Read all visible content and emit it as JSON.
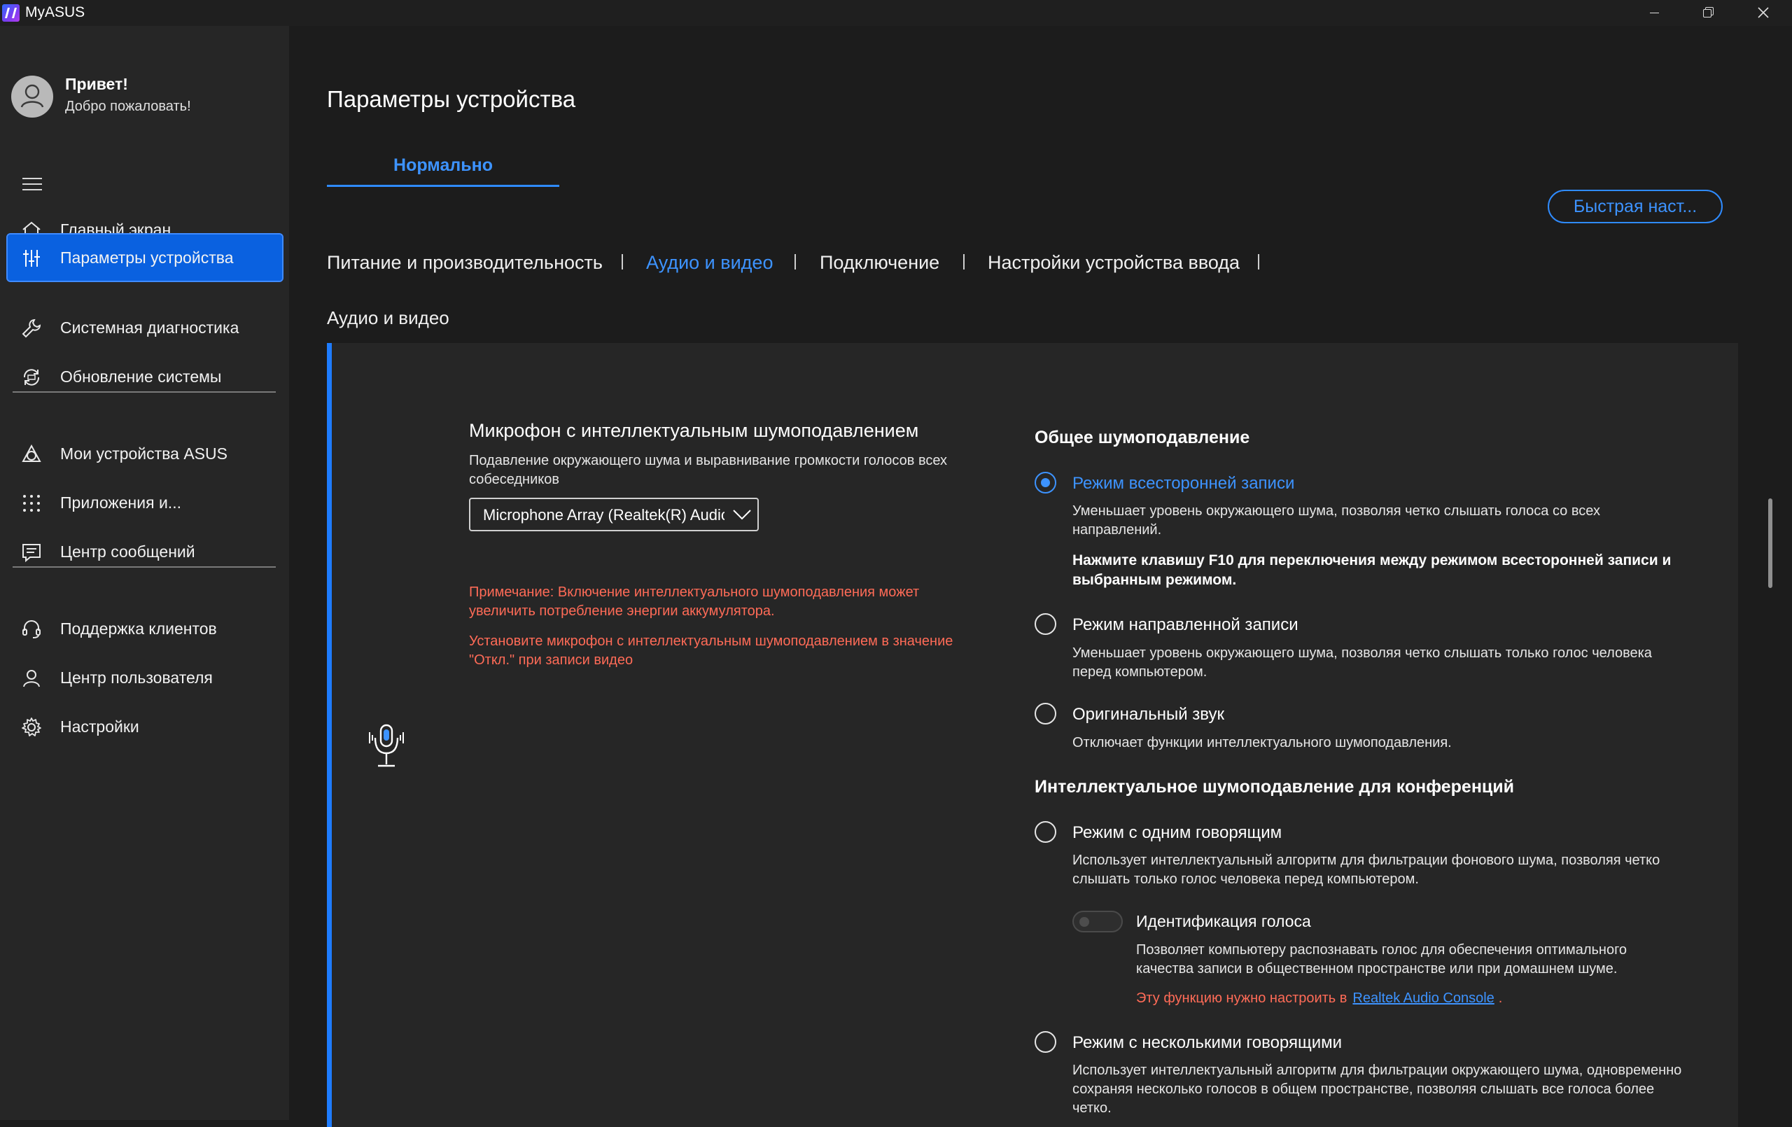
{
  "window": {
    "title": "MyASUS"
  },
  "sidebar": {
    "greeting_title": "Привет!",
    "greeting_subtitle": "Добро пожаловать!",
    "items": [
      {
        "label": "Главный экран",
        "icon": "home-icon",
        "active": false
      },
      {
        "label": "Параметры устройства",
        "icon": "sliders-icon",
        "active": true
      },
      {
        "label": "Системная диагностика",
        "icon": "wrench-icon",
        "active": false
      },
      {
        "label": "Обновление системы",
        "icon": "update-icon",
        "active": false
      },
      {
        "label": "Мои устройства ASUS",
        "icon": "devices-icon",
        "active": false
      },
      {
        "label": "Приложения и...",
        "icon": "apps-grid-icon",
        "active": false
      },
      {
        "label": "Центр сообщений",
        "icon": "message-icon",
        "active": false
      },
      {
        "label": "Поддержка клиентов",
        "icon": "headset-icon",
        "active": false
      },
      {
        "label": "Центр пользователя",
        "icon": "user-icon",
        "active": false
      },
      {
        "label": "Настройки",
        "icon": "gear-icon",
        "active": false
      }
    ]
  },
  "main": {
    "page_title": "Параметры устройства",
    "mode_tab": "Нормально",
    "quick_button": "Быстрая наст...",
    "subtabs": [
      {
        "label": "Питание и производительность",
        "active": false
      },
      {
        "label": "Аудио и видео",
        "active": true
      },
      {
        "label": "Подключение",
        "active": false
      },
      {
        "label": "Настройки устройства ввода",
        "active": false
      }
    ],
    "section_label": "Аудио и видео"
  },
  "mic_card": {
    "title": "Микрофон с интеллектуальным шумоподавлением",
    "description": "Подавление окружающего шума и выравнивание громкости голосов всех собеседников",
    "device_select_value": "Microphone Array (Realtek(R) Audio)",
    "warning_1": "Примечание: Включение интеллектуального шумоподавления может увеличить потребление энергии аккумулятора.",
    "warning_2": "Установите микрофон с интеллектуальным шумоподавлением в значение \"Откл.\" при записи видео"
  },
  "noise_general": {
    "heading": "Общее шумоподавление",
    "omni": {
      "label": "Режим всесторонней записи",
      "desc": "Уменьшает уровень окружающего шума, позволяя четко слышать голоса со всех направлений.",
      "bold_note": "Нажмите клавишу F10 для переключения между режимом всесторонней записи и выбранным режимом.",
      "selected": true
    },
    "directional": {
      "label": "Режим направленной записи",
      "desc": "Уменьшает уровень окружающего шума, позволяя четко слышать только голос человека перед компьютером.",
      "selected": false
    },
    "original": {
      "label": "Оригинальный звук",
      "desc": "Отключает функции интеллектуального шумоподавления.",
      "selected": false
    }
  },
  "noise_conference": {
    "heading": "Интеллектуальное шумоподавление для конференций",
    "single": {
      "label": "Режим с одним говорящим",
      "desc": "Использует интеллектуальный алгоритм для фильтрации фонового шума, позволяя четко слышать только голос человека перед компьютером.",
      "selected": false
    },
    "voice_id": {
      "label": "Идентификация голоса",
      "desc": "Позволяет компьютеру распознавать голос для обеспечения оптимального качества записи в общественном пространстве или при домашнем шуме.",
      "note": "Эту функцию нужно настроить в",
      "link": "Realtek Audio Console",
      "note_end": ".",
      "enabled": false
    },
    "multi": {
      "label": "Режим с несколькими говорящими",
      "desc": "Использует интеллектуальный алгоритм для фильтрации окружающего шума, одновременно сохраняя несколько голосов в общем пространстве, позволяя слышать все голоса более четко.",
      "selected": false
    }
  },
  "colors": {
    "accent": "#3d93ff",
    "active_nav": "#0a61e0",
    "warning": "#ff6b57",
    "background": "#1c1c1c",
    "sidebar": "#262626"
  }
}
